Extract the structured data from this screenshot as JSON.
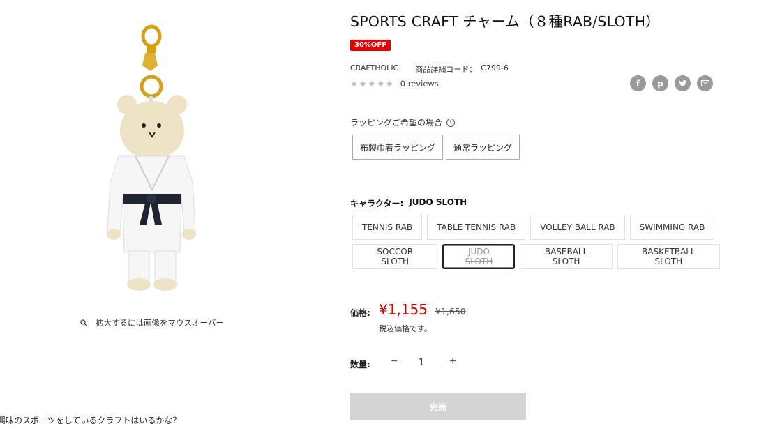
{
  "gallery": {
    "zoom_hint": "拡大するには画像をマウスオーバー",
    "teaser": "興味のスポーツをしているクラフトはいるかな？"
  },
  "product": {
    "title": "SPORTS CRAFT チャーム（８種RAB/SLOTH）",
    "badge": "30%OFF",
    "brand": "CRAFTHOLIC",
    "sku_label": "商品詳細コード：",
    "sku": "C799-6",
    "stars": "★★★★★",
    "reviews": "0 reviews",
    "share_icons": [
      "facebook-icon",
      "pinterest-icon",
      "twitter-icon",
      "email-icon"
    ]
  },
  "wrapping": {
    "label": "ラッピングご希望の場合",
    "options": [
      "布製巾着ラッピング",
      "通常ラッピング"
    ]
  },
  "character": {
    "label": "キャラクター:",
    "selected": "JUDO SLOTH",
    "row1": [
      "TENNIS RAB",
      "TABLE TENNIS RAB",
      "VOLLEY BALL RAB",
      "SWIMMING RAB"
    ],
    "row2": [
      "SOCCOR SLOTH",
      "JUDO SLOTH",
      "BASEBALL SLOTH",
      "BASKETBALL SLOTH"
    ]
  },
  "price": {
    "label": "価格:",
    "sale": "¥1,155",
    "compare": "¥1,650",
    "tax_note": "税込価格です。"
  },
  "quantity": {
    "label": "数量:",
    "minus": "−",
    "value": "1",
    "plus": "+"
  },
  "cart": {
    "soldout_label": "完売"
  },
  "colors": {
    "sale_red": "#d00000",
    "badge_red": "#e00000",
    "soldout_gray": "#d4d4d4"
  }
}
